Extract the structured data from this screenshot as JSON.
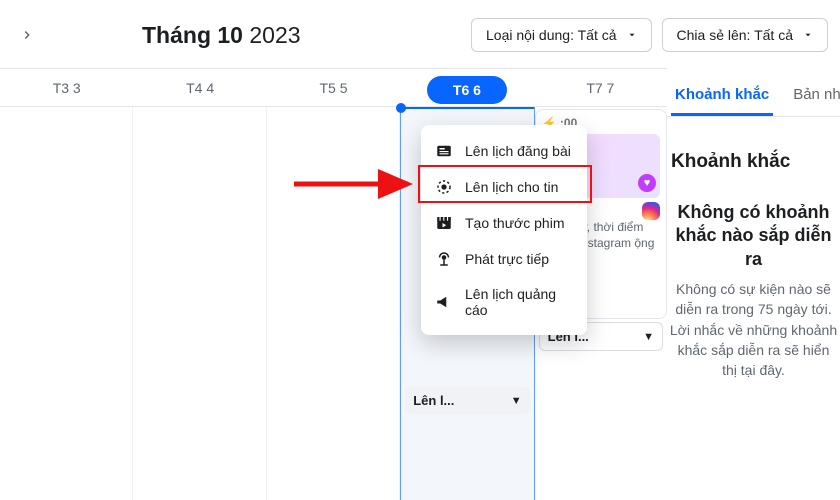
{
  "header": {
    "title_strong": "Tháng 10",
    "title_rest": " 2023",
    "content_type_label": "Loại nội dung: Tất cả",
    "share_to_label": "Chia sẻ lên: Tất cả"
  },
  "days": [
    {
      "label": "T3 3"
    },
    {
      "label": "T4 4"
    },
    {
      "label": "T5 5"
    },
    {
      "label": "T6 6",
      "active": true
    },
    {
      "label": "T7 7"
    }
  ],
  "menu": {
    "items": [
      {
        "icon": "post",
        "label": "Lên lịch đăng bài"
      },
      {
        "icon": "story",
        "label": "Lên lịch cho tin"
      },
      {
        "icon": "reel",
        "label": "Tạo thước phim"
      },
      {
        "icon": "live",
        "label": "Phát trực tiếp"
      },
      {
        "icon": "ad",
        "label": "Lên lịch quảng cáo"
      }
    ]
  },
  "card": {
    "time": "  :00",
    "text_lines": "tuần này, thời điểm theo dõi stagram ộng tích hất."
  },
  "pill_t6": "Lên l...",
  "pill_t7": "Lên l...",
  "side": {
    "tabs": {
      "moments": "Khoảnh khắc",
      "notes": "Bản nha"
    },
    "heading": "Khoảnh khắc",
    "empty_title": "Không có khoảnh khắc nào sắp diễn ra",
    "empty_desc": "Không có sự kiện nào sẽ diễn ra trong 75 ngày tới. Lời nhắc về những khoảnh khắc sắp diễn ra sẽ hiển thị tại đây."
  }
}
